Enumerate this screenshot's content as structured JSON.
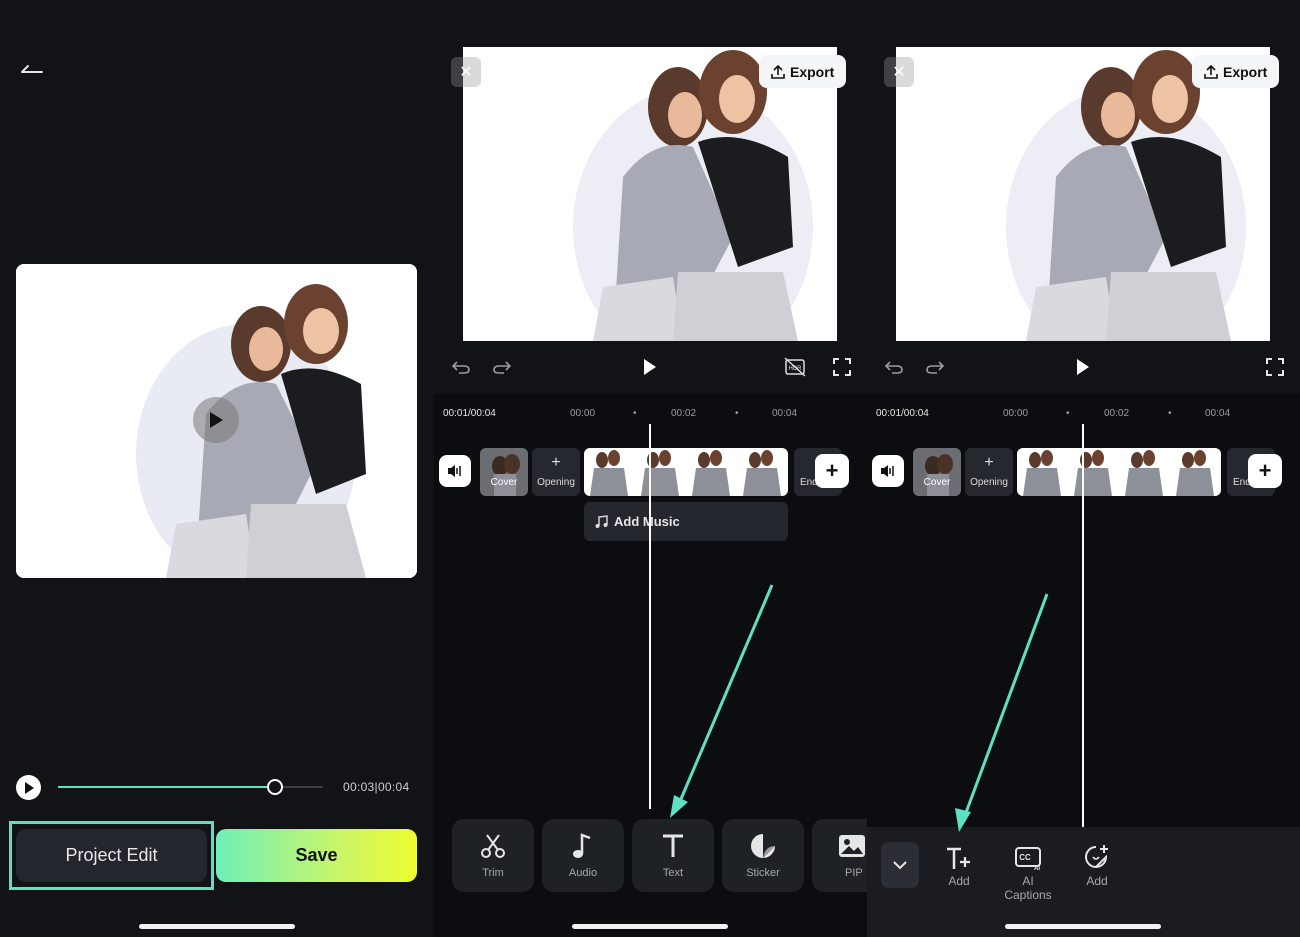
{
  "panel1": {
    "time_display": "00:03|00:04",
    "progress_fraction": 0.82,
    "project_edit_label": "Project Edit",
    "save_label": "Save"
  },
  "panel2": {
    "export_label": "Export",
    "time_current": "00:01/00:04",
    "time_ticks": [
      "00:00",
      "00:02",
      "00:04"
    ],
    "cover_label": "Cover",
    "opening_label": "Opening",
    "end_label": "End",
    "add_music_label": "Add Music",
    "tools": [
      {
        "label": "Trim",
        "icon": "scissors-icon"
      },
      {
        "label": "Audio",
        "icon": "music-note-icon"
      },
      {
        "label": "Text",
        "icon": "text-icon"
      },
      {
        "label": "Sticker",
        "icon": "sticker-icon"
      },
      {
        "label": "PIP",
        "icon": "pip-icon"
      }
    ]
  },
  "panel3": {
    "export_label": "Export",
    "time_current": "00:01/00:04",
    "time_ticks": [
      "00:00",
      "00:02",
      "00:04"
    ],
    "cover_label": "Cover",
    "opening_label": "Opening",
    "end_label": "End",
    "text_tools": [
      {
        "label": "Add",
        "icon": "add-text-icon"
      },
      {
        "label": "AI Captions",
        "icon": "ai-captions-icon"
      },
      {
        "label": "Add",
        "icon": "add-sticker-icon"
      }
    ]
  },
  "colors": {
    "accent": "#5fe0c3",
    "background": "#121317",
    "save_gradient_start": "#6ff0ba",
    "save_gradient_end": "#eefc2f"
  }
}
